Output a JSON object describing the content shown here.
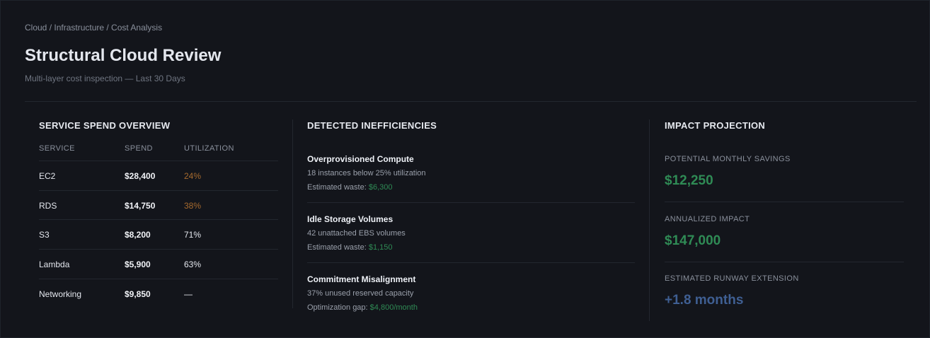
{
  "breadcrumb": "Cloud / Infrastructure / Cost Analysis",
  "title": "Structural Cloud Review",
  "subtitle": "Multi-layer cost inspection — Last 30 Days",
  "colors": {
    "background": "#13151b",
    "savings_green": "#2f8b55",
    "warning_orange": "#a66a2e",
    "runway_blue": "#3f5f93"
  },
  "spend": {
    "heading": "SERVICE SPEND OVERVIEW",
    "columns": [
      "SERVICE",
      "SPEND",
      "UTILIZATION"
    ],
    "rows": [
      {
        "service": "EC2",
        "spend": "$28,400",
        "utilization": "24%"
      },
      {
        "service": "RDS",
        "spend": "$14,750",
        "utilization": "38%"
      },
      {
        "service": "S3",
        "spend": "$8,200",
        "utilization": "71%"
      },
      {
        "service": "Lambda",
        "spend": "$5,900",
        "utilization": "63%"
      },
      {
        "service": "Networking",
        "spend": "$9,850",
        "utilization": "—"
      }
    ]
  },
  "inefficiencies": {
    "heading": "DETECTED INEFFICIENCIES",
    "items": [
      {
        "name": "Overprovisioned Compute",
        "desc": "18 instances below 25% utilization",
        "metric_label": "Estimated waste:",
        "metric_value": "$6,300"
      },
      {
        "name": "Idle Storage Volumes",
        "desc": "42 unattached EBS volumes",
        "metric_label": "Estimated waste:",
        "metric_value": "$1,150"
      },
      {
        "name": "Commitment Misalignment",
        "desc": "37% unused reserved capacity",
        "metric_label": "Optimization gap:",
        "metric_value": "$4,800/month"
      }
    ]
  },
  "impact": {
    "heading": "IMPACT PROJECTION",
    "metrics": [
      {
        "label": "POTENTIAL MONTHLY SAVINGS",
        "value": "$12,250"
      },
      {
        "label": "ANNUALIZED IMPACT",
        "value": "$147,000"
      },
      {
        "label": "ESTIMATED RUNWAY EXTENSION",
        "value": "+1.8 months"
      }
    ]
  }
}
